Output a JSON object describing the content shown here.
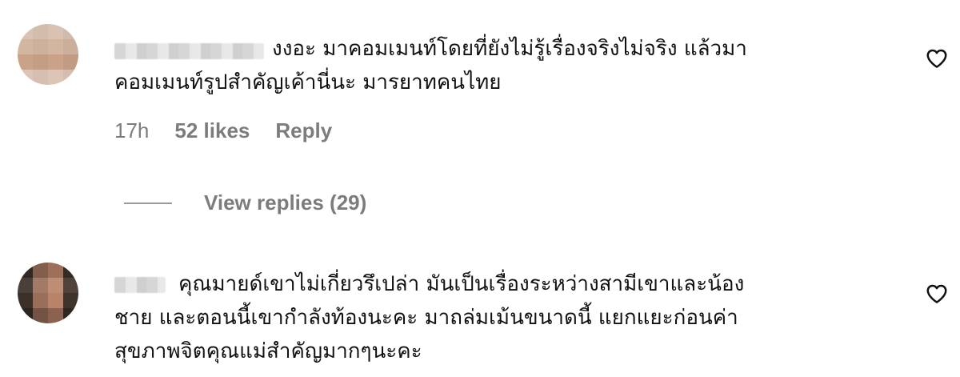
{
  "comments": [
    {
      "text": "งงอะ มาคอมเมนท์โดยที่ยังไม่รู้เรื่องจริงไม่จริง แล้วมา\nคอมเมนท์รูปสำคัญเค้านี่นะ มารยาทคนไทย",
      "time": "17h",
      "likes": "52 likes",
      "reply_label": "Reply",
      "view_replies_label": "View replies (29)",
      "like_icon": "heart-outline-icon"
    },
    {
      "text": "คุณมายด์เขาไม่เกี่ยวรึเปล่า มันเป็นเรื่องระหว่างสามีเขาและน้อง\nชาย และตอนนี้เขากำลังท้องนะคะ มาถล่มเม้นขนาดนี้ แยกแยะก่อนค่า\nสุขภาพจิตคุณแม่สำคัญมากๆนะคะ",
      "like_icon": "heart-outline-icon"
    }
  ],
  "colors": {
    "text": "#111111",
    "secondary_text": "#7c7c7c",
    "background": "#ffffff"
  }
}
